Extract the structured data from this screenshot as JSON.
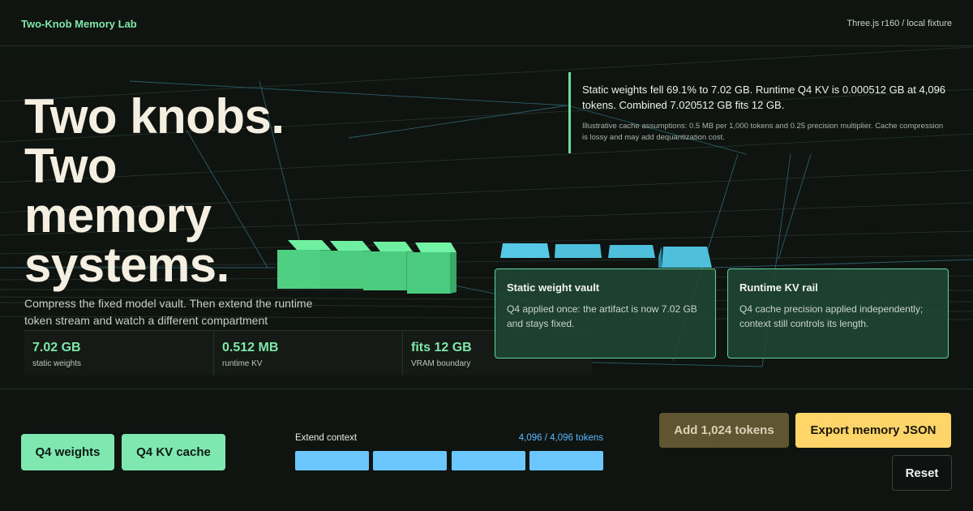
{
  "header": {
    "brand": "Two-Knob Memory Lab",
    "note": "Three.js r160 / local fixture"
  },
  "hero": {
    "headline_lines": [
      "Two knobs.",
      "Two",
      "memory",
      "systems."
    ],
    "subcopy": "Compress the fixed model vault. Then extend the runtime token stream and watch a different compartment"
  },
  "status": {
    "main": "Static weights fell 69.1% to 7.02 GB. Runtime Q4 KV is 0.000512 GB at 4,096 tokens. Combined 7.020512 GB fits 12 GB.",
    "note": "Illustrative cache assumptions: 0.5 MB per 1,000 tokens and 0.25 precision multiplier. Cache compression is lossy and may add dequantization cost."
  },
  "metrics": [
    {
      "value": "7.02 GB",
      "label": "static weights"
    },
    {
      "value": "0.512 MB",
      "label": "runtime KV"
    },
    {
      "value": "fits 12 GB",
      "label": "VRAM boundary"
    }
  ],
  "cards": {
    "weight": {
      "title": "Static weight vault",
      "body": "Q4 applied once: the artifact is now 7.02 GB and stays fixed."
    },
    "kv": {
      "title": "Runtime KV rail",
      "body": "Q4 cache precision applied independently; context still controls its length."
    }
  },
  "controls": {
    "q4_weights": "Q4 weights",
    "q4_kv": "Q4 KV cache",
    "context_label": "Extend context",
    "context_count": "4,096 / 4,096 tokens",
    "context_fill": 1.0,
    "context_segments": 4,
    "add_tokens": "Add 1,024 tokens",
    "export": "Export memory JSON",
    "reset": "Reset"
  },
  "colors": {
    "accent_green": "#7ee8b0",
    "kv_blue": "#5ab8ff",
    "export_yellow": "#ffd56a",
    "heading_cream": "#f5efe2"
  }
}
